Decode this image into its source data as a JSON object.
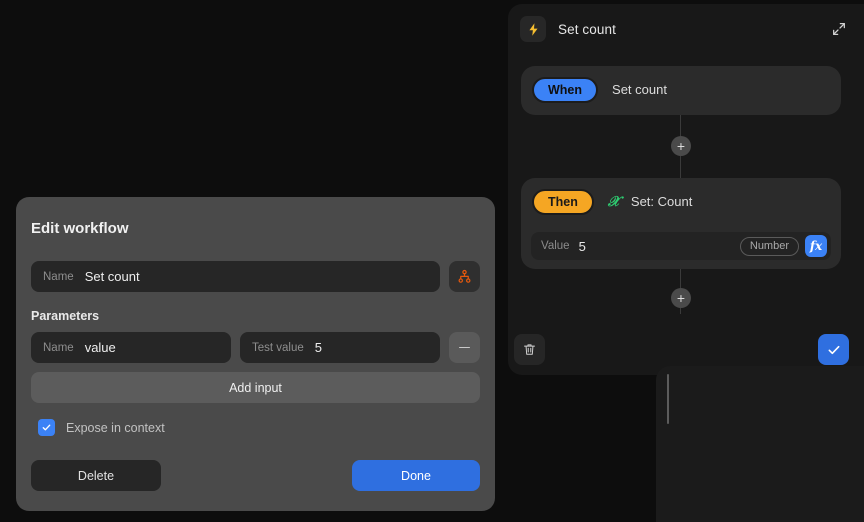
{
  "workflow_panel": {
    "icon": "lightning-bolt-icon",
    "title": "Set count",
    "expand_icon": "expand-arrows-icon",
    "nodes": [
      {
        "pill": "When",
        "pill_color": "#3b82f6",
        "label": "Set count"
      },
      {
        "pill": "Then",
        "pill_color": "#f5a623",
        "type_icon": "variable-x-icon",
        "label": "Set: Count",
        "value_row": {
          "key": "Value",
          "value": "5",
          "badge": "Number",
          "formula_button": "fx"
        }
      }
    ],
    "add_node_label": "+",
    "actions": {
      "delete_icon": "trash-icon",
      "confirm_icon": "check-icon"
    }
  },
  "dialog": {
    "title": "Edit workflow",
    "name_field": {
      "key": "Name",
      "value": "Set count",
      "placeholder": "Name"
    },
    "hierarchy_icon": "hierarchy-icon",
    "parameters_label": "Parameters",
    "parameters": [
      {
        "name_key": "Name",
        "name_value": "value",
        "test_key": "Test value",
        "test_value": "5",
        "remove_icon": "minus-icon"
      }
    ],
    "add_input_label": "Add input",
    "expose_checkbox": {
      "label": "Expose in context",
      "checked": true
    },
    "delete_label": "Delete",
    "done_label": "Done"
  },
  "colors": {
    "accent_blue": "#3b82f6",
    "accent_orange": "#f5a623",
    "accent_green": "#2ecc71",
    "icon_orange": "#e8590c",
    "background": "#0d0d0d"
  }
}
